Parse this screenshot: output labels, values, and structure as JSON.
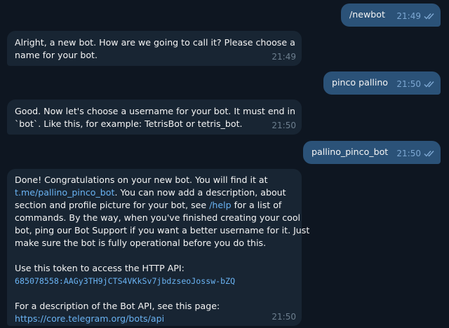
{
  "messages": [
    {
      "from": "me",
      "text": "/newbot",
      "time": "21:49",
      "status": "read"
    },
    {
      "from": "bot",
      "lines": [
        "Alright, a new bot. How are we going to call it? Please choose a",
        "name for your bot."
      ],
      "time": "21:49"
    },
    {
      "from": "me",
      "text": "pinco pallino",
      "time": "21:50",
      "status": "read"
    },
    {
      "from": "bot",
      "lines": [
        "Good. Now let's choose a username for your bot. It must end in",
        "`bot`. Like this, for example: TetrisBot or tetris_bot."
      ],
      "time": "21:50"
    },
    {
      "from": "me",
      "text": "pallino_pinco_bot",
      "time": "21:50",
      "status": "read"
    },
    {
      "from": "bot",
      "line1": "Done! Congratulations on your new bot. You will find it at",
      "line2_link": "t.me/pallino_pinco_bot",
      "line2_rest": ". You can now add a description, about",
      "line3_pre": "section and profile picture for your bot, see ",
      "line3_link": "/help",
      "line3_post": " for a list of",
      "line4": "commands. By the way, when you've finished creating your cool",
      "line5": "bot, ping our Bot Support if you want a better username for it. Just",
      "line6": "make sure the bot is fully operational before you do this.",
      "token_label": "Use this token to access the HTTP API:",
      "token": "685078558:AAGy3TH9jCTS4VKkSv7jbdzseoJossw-bZQ",
      "api_label": "For a description of the Bot API, see this page:",
      "api_link": "https://core.telegram.org/bots/api",
      "time": "21:50"
    }
  ],
  "icons": {
    "read_ticks": "double-check-icon"
  },
  "colors": {
    "background": "#0e1621",
    "outgoing_bubble": "#2b5278",
    "incoming_bubble": "#182533",
    "link": "#6ab3f3"
  }
}
